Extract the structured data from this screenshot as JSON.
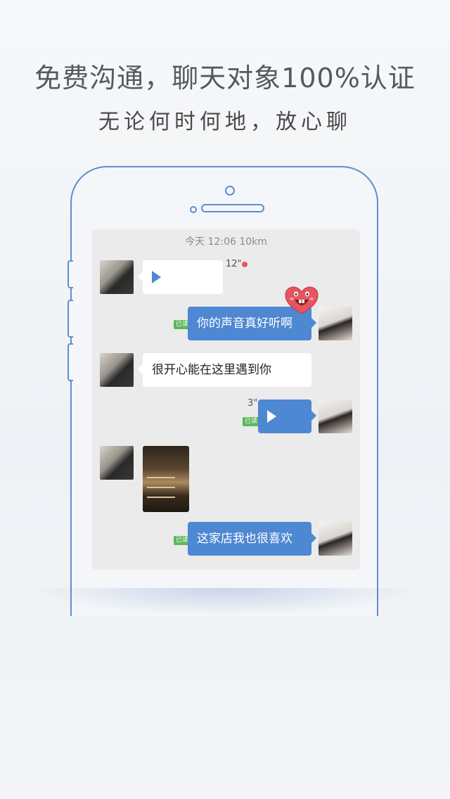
{
  "headline": "免费沟通，聊天对象100%认证",
  "subline": "无论何时何地，放心聊",
  "chat": {
    "timestamp": "今天 12:06  10km",
    "voice_in": {
      "duration": "12\""
    },
    "msg_out_1": {
      "text": "你的声音真好听啊",
      "status": "已读"
    },
    "msg_in_2": {
      "text": "很开心能在这里遇到你"
    },
    "voice_out": {
      "duration": "3\"",
      "status": "已读"
    },
    "msg_out_3": {
      "text": "这家店我也很喜欢",
      "status": "已读"
    }
  },
  "colors": {
    "accent": "#4e87d2",
    "phone_outline": "#5b8fd0",
    "read_badge": "#5cb85c",
    "unread_dot": "#e8556b"
  },
  "icons": [
    "play-icon",
    "heart-sticker-icon"
  ]
}
